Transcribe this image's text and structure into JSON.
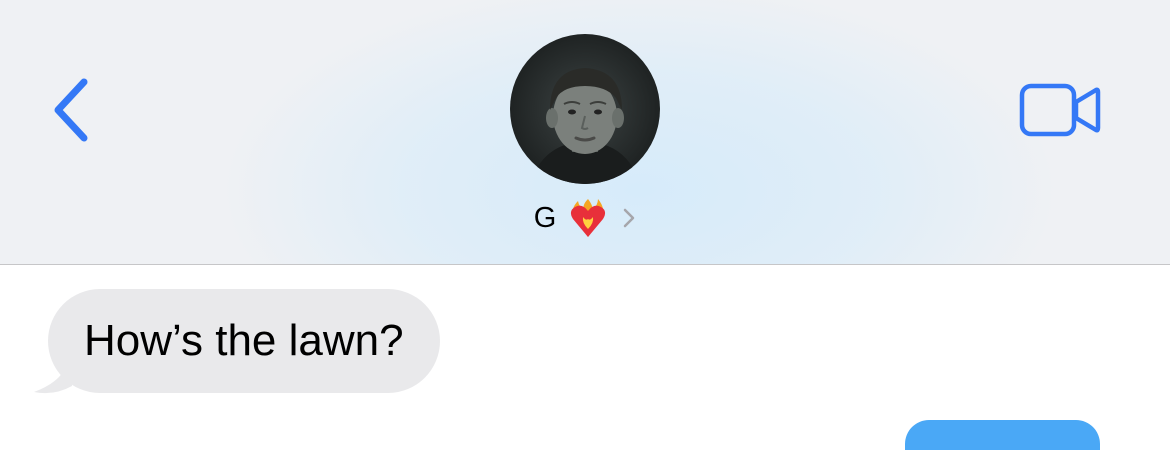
{
  "header": {
    "back_icon": "chevron-left-icon",
    "video_icon": "video-camera-icon",
    "accent_color": "#3478f6",
    "contact": {
      "name": "G",
      "emoji_icon": "heart-on-fire-icon",
      "disclosure_icon": "chevron-right-icon"
    }
  },
  "messages": [
    {
      "direction": "received",
      "text": "How’s the lawn?"
    }
  ],
  "colors": {
    "received_bubble": "#e9e9eb",
    "sent_bubble": "#4aa8f6"
  }
}
